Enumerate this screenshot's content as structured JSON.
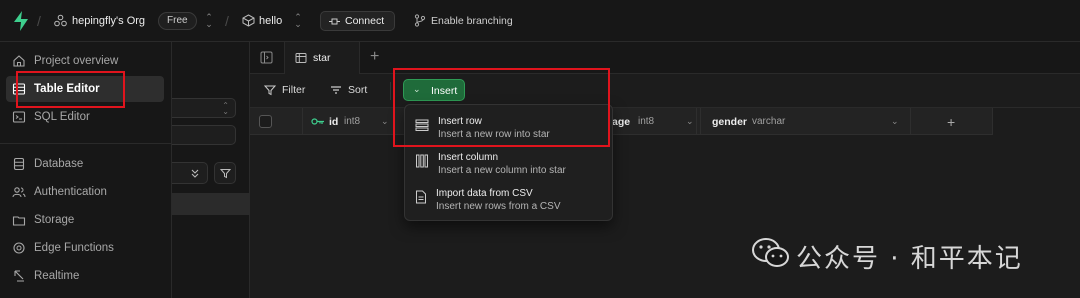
{
  "topbar": {
    "org_name": "hepingfly's Org",
    "plan_badge": "Free",
    "project_name": "hello",
    "connect_label": "Connect",
    "branching_label": "Enable branching"
  },
  "sidebar": {
    "items": [
      {
        "label": "Project overview",
        "icon": "home-icon"
      },
      {
        "label": "Table Editor",
        "icon": "table-icon",
        "active": true
      },
      {
        "label": "SQL Editor",
        "icon": "terminal-icon"
      },
      {
        "label": "Database",
        "icon": "database-icon"
      },
      {
        "label": "Authentication",
        "icon": "users-icon"
      },
      {
        "label": "Storage",
        "icon": "archive-icon"
      },
      {
        "label": "Edge Functions",
        "icon": "functions-icon"
      },
      {
        "label": "Realtime",
        "icon": "realtime-icon"
      }
    ]
  },
  "tabs": {
    "active_tab": "star"
  },
  "toolbar": {
    "filter_label": "Filter",
    "sort_label": "Sort",
    "insert_label": "Insert"
  },
  "grid": {
    "columns": [
      {
        "name": "id",
        "type": "int8",
        "primary_key": true
      },
      {
        "name": "age",
        "type": "int8"
      },
      {
        "name": "gender",
        "type": "varchar"
      }
    ]
  },
  "insert_menu": {
    "items": [
      {
        "title": "Insert row",
        "desc": "Insert a new row into star",
        "icon": "rows-icon"
      },
      {
        "title": "Insert column",
        "desc": "Insert a new column into star",
        "icon": "columns-icon"
      },
      {
        "title": "Import data from CSV",
        "desc": "Insert new rows from a CSV",
        "icon": "file-icon"
      }
    ]
  },
  "watermark": {
    "text": "公众号 · 和平本记"
  },
  "colors": {
    "accent_green": "#1f6b3a",
    "highlight_red": "#e0141d",
    "background": "#171717"
  }
}
